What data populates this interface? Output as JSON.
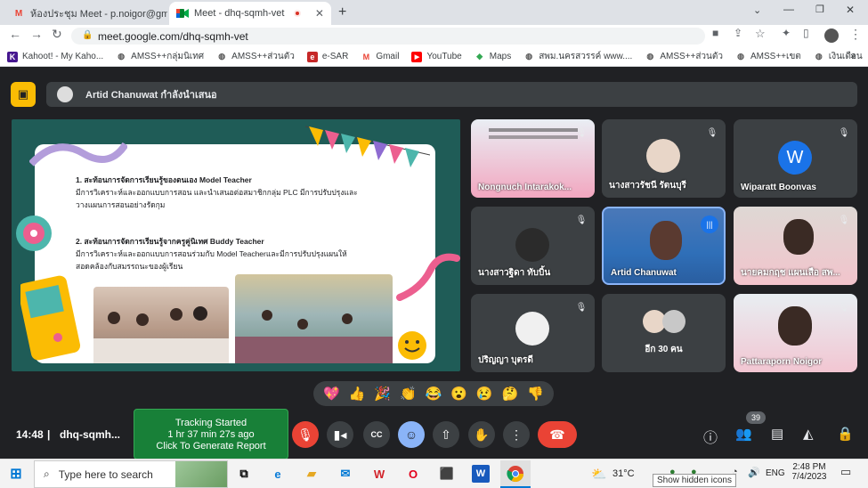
{
  "browser": {
    "tabs": [
      {
        "title": "ห้องประชุม Meet - p.noigor@gmai",
        "icon": "gmail-icon"
      },
      {
        "title": "Meet - dhq-sqmh-vet",
        "icon": "meet-icon"
      }
    ],
    "url": "meet.google.com/dhq-sqmh-vet",
    "bookmarks": [
      "Kahoot! - My Kaho...",
      "AMSS++กลุ่มนิเทศ",
      "AMSS++ส่วนตัว",
      "e-SAR",
      "Gmail",
      "YouTube",
      "Maps",
      "สพม.นครสวรรค์ www....",
      "AMSS++ส่วนตัว",
      "AMSS++เขต",
      "เงินเดือน"
    ]
  },
  "meet": {
    "presenter_banner": "Artid Chanuwat กำลังนำเสนอ",
    "slide": {
      "item1_title": "1. สะท้อนการจัดการเรียนรู้ของตนเอง Model Teacher",
      "item1_body": "มีการวิเคราะห์และออกแบบการสอน และนำเสนอต่อสมาชิกกลุ่ม PLC มีการปรับปรุงและวางแผนการสอนอย่างรัดกุม",
      "item2_title": "2. สะท้อนการจัดการเรียนรู้จากครูคู่นิเทศ Buddy Teacher",
      "item2_body": "มีการวิเคราะห์และออกแบบการสอนร่วมกับ Model Teacherและมีการปรับปรุงแผนให้สอดคล้องกับสมรรถนะของผู้เรียน"
    },
    "participants": [
      {
        "name": "Nongnuch Intarakok...",
        "muted": true
      },
      {
        "name": "นางสาวรัชนี รัตนบุรี",
        "muted": true
      },
      {
        "name": "Wiparatt Boonvas",
        "muted": true,
        "initial": "W"
      },
      {
        "name": "นางสาวฐิดา ทับบิ้น",
        "muted": true
      },
      {
        "name": "Artid Chanuwat",
        "muted": false
      },
      {
        "name": "นายคมกฤช แผนเสือ สพ...",
        "muted": true
      },
      {
        "name": "ปริญญา บุตรดี",
        "muted": true
      },
      {
        "name": "อีก 30 คน",
        "muted": false
      },
      {
        "name": "Pattaraporn Noigor",
        "muted": true
      }
    ],
    "meeting_time": "14:48",
    "meeting_code": "dhq-sqmh...",
    "tracking": {
      "line1": "Tracking Started",
      "line2": "1 hr 37 min 27s ago",
      "line3": "Click To Generate Report"
    },
    "people_count": "39",
    "reactions": [
      "💖",
      "👍",
      "🎉",
      "👏",
      "😂",
      "😮",
      "😢",
      "🤔",
      "👎"
    ]
  },
  "taskbar": {
    "search_placeholder": "Type here to search",
    "weather": "31°C",
    "lang": "ENG",
    "time": "2:48 PM",
    "date": "7/4/2023",
    "tooltip": "Show hidden icons"
  },
  "colors": {
    "end_call": "#ea4335",
    "accent": "#8ab4f8",
    "tracking_bg": "#188038",
    "presenter_badge": "#fbbc04"
  }
}
